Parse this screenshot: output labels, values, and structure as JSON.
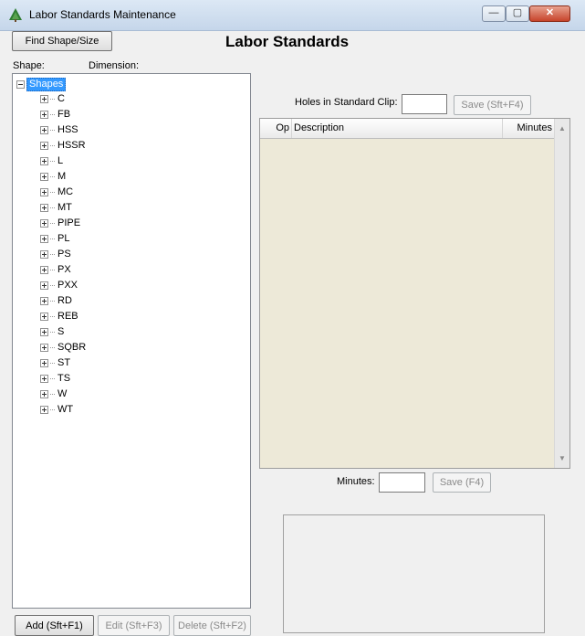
{
  "window": {
    "title": "Labor Standards Maintenance",
    "minimize_glyph": "—",
    "maximize_glyph": "▢",
    "close_glyph": "✕"
  },
  "toolbar": {
    "find_shape_label": "Find Shape/Size"
  },
  "page_title": "Labor Standards",
  "labels": {
    "shape": "Shape:",
    "dimension": "Dimension:"
  },
  "tree": {
    "root_label": "Shapes",
    "items": [
      "C",
      "FB",
      "HSS",
      "HSSR",
      "L",
      "M",
      "MC",
      "MT",
      "PIPE",
      "PL",
      "PS",
      "PX",
      "PXX",
      "RD",
      "REB",
      "S",
      "SQBR",
      "ST",
      "TS",
      "W",
      "WT"
    ]
  },
  "clip": {
    "label": "Holes in Standard Clip:",
    "value": "",
    "save_label": "Save (Sft+F4)"
  },
  "ops_table": {
    "columns": [
      "Op",
      "Description",
      "Minutes"
    ],
    "rows": []
  },
  "minutes": {
    "label": "Minutes:",
    "value": "",
    "save_label": "Save (F4)"
  },
  "buttons": {
    "add": "Add (Sft+F1)",
    "edit": "Edit (Sft+F3)",
    "delete": "Delete (Sft+F2)"
  },
  "colors": {
    "selection": "#3399ff",
    "table_bg": "#ede9d8"
  }
}
